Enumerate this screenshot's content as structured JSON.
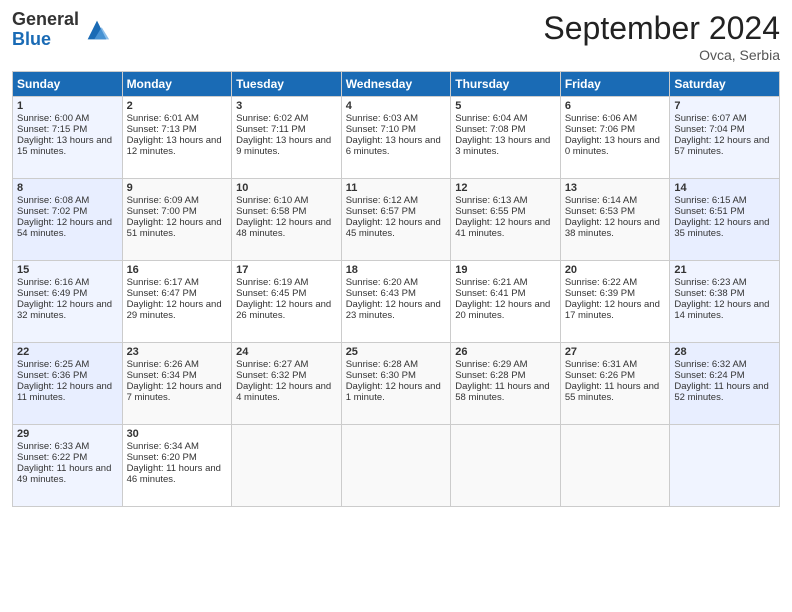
{
  "logo": {
    "general": "General",
    "blue": "Blue"
  },
  "title": "September 2024",
  "location": "Ovca, Serbia",
  "days_of_week": [
    "Sunday",
    "Monday",
    "Tuesday",
    "Wednesday",
    "Thursday",
    "Friday",
    "Saturday"
  ],
  "weeks": [
    [
      {
        "day": "1",
        "sunrise": "Sunrise: 6:00 AM",
        "sunset": "Sunset: 7:15 PM",
        "daylight": "Daylight: 13 hours and 15 minutes."
      },
      {
        "day": "2",
        "sunrise": "Sunrise: 6:01 AM",
        "sunset": "Sunset: 7:13 PM",
        "daylight": "Daylight: 13 hours and 12 minutes."
      },
      {
        "day": "3",
        "sunrise": "Sunrise: 6:02 AM",
        "sunset": "Sunset: 7:11 PM",
        "daylight": "Daylight: 13 hours and 9 minutes."
      },
      {
        "day": "4",
        "sunrise": "Sunrise: 6:03 AM",
        "sunset": "Sunset: 7:10 PM",
        "daylight": "Daylight: 13 hours and 6 minutes."
      },
      {
        "day": "5",
        "sunrise": "Sunrise: 6:04 AM",
        "sunset": "Sunset: 7:08 PM",
        "daylight": "Daylight: 13 hours and 3 minutes."
      },
      {
        "day": "6",
        "sunrise": "Sunrise: 6:06 AM",
        "sunset": "Sunset: 7:06 PM",
        "daylight": "Daylight: 13 hours and 0 minutes."
      },
      {
        "day": "7",
        "sunrise": "Sunrise: 6:07 AM",
        "sunset": "Sunset: 7:04 PM",
        "daylight": "Daylight: 12 hours and 57 minutes."
      }
    ],
    [
      {
        "day": "8",
        "sunrise": "Sunrise: 6:08 AM",
        "sunset": "Sunset: 7:02 PM",
        "daylight": "Daylight: 12 hours and 54 minutes."
      },
      {
        "day": "9",
        "sunrise": "Sunrise: 6:09 AM",
        "sunset": "Sunset: 7:00 PM",
        "daylight": "Daylight: 12 hours and 51 minutes."
      },
      {
        "day": "10",
        "sunrise": "Sunrise: 6:10 AM",
        "sunset": "Sunset: 6:58 PM",
        "daylight": "Daylight: 12 hours and 48 minutes."
      },
      {
        "day": "11",
        "sunrise": "Sunrise: 6:12 AM",
        "sunset": "Sunset: 6:57 PM",
        "daylight": "Daylight: 12 hours and 45 minutes."
      },
      {
        "day": "12",
        "sunrise": "Sunrise: 6:13 AM",
        "sunset": "Sunset: 6:55 PM",
        "daylight": "Daylight: 12 hours and 41 minutes."
      },
      {
        "day": "13",
        "sunrise": "Sunrise: 6:14 AM",
        "sunset": "Sunset: 6:53 PM",
        "daylight": "Daylight: 12 hours and 38 minutes."
      },
      {
        "day": "14",
        "sunrise": "Sunrise: 6:15 AM",
        "sunset": "Sunset: 6:51 PM",
        "daylight": "Daylight: 12 hours and 35 minutes."
      }
    ],
    [
      {
        "day": "15",
        "sunrise": "Sunrise: 6:16 AM",
        "sunset": "Sunset: 6:49 PM",
        "daylight": "Daylight: 12 hours and 32 minutes."
      },
      {
        "day": "16",
        "sunrise": "Sunrise: 6:17 AM",
        "sunset": "Sunset: 6:47 PM",
        "daylight": "Daylight: 12 hours and 29 minutes."
      },
      {
        "day": "17",
        "sunrise": "Sunrise: 6:19 AM",
        "sunset": "Sunset: 6:45 PM",
        "daylight": "Daylight: 12 hours and 26 minutes."
      },
      {
        "day": "18",
        "sunrise": "Sunrise: 6:20 AM",
        "sunset": "Sunset: 6:43 PM",
        "daylight": "Daylight: 12 hours and 23 minutes."
      },
      {
        "day": "19",
        "sunrise": "Sunrise: 6:21 AM",
        "sunset": "Sunset: 6:41 PM",
        "daylight": "Daylight: 12 hours and 20 minutes."
      },
      {
        "day": "20",
        "sunrise": "Sunrise: 6:22 AM",
        "sunset": "Sunset: 6:39 PM",
        "daylight": "Daylight: 12 hours and 17 minutes."
      },
      {
        "day": "21",
        "sunrise": "Sunrise: 6:23 AM",
        "sunset": "Sunset: 6:38 PM",
        "daylight": "Daylight: 12 hours and 14 minutes."
      }
    ],
    [
      {
        "day": "22",
        "sunrise": "Sunrise: 6:25 AM",
        "sunset": "Sunset: 6:36 PM",
        "daylight": "Daylight: 12 hours and 11 minutes."
      },
      {
        "day": "23",
        "sunrise": "Sunrise: 6:26 AM",
        "sunset": "Sunset: 6:34 PM",
        "daylight": "Daylight: 12 hours and 7 minutes."
      },
      {
        "day": "24",
        "sunrise": "Sunrise: 6:27 AM",
        "sunset": "Sunset: 6:32 PM",
        "daylight": "Daylight: 12 hours and 4 minutes."
      },
      {
        "day": "25",
        "sunrise": "Sunrise: 6:28 AM",
        "sunset": "Sunset: 6:30 PM",
        "daylight": "Daylight: 12 hours and 1 minute."
      },
      {
        "day": "26",
        "sunrise": "Sunrise: 6:29 AM",
        "sunset": "Sunset: 6:28 PM",
        "daylight": "Daylight: 11 hours and 58 minutes."
      },
      {
        "day": "27",
        "sunrise": "Sunrise: 6:31 AM",
        "sunset": "Sunset: 6:26 PM",
        "daylight": "Daylight: 11 hours and 55 minutes."
      },
      {
        "day": "28",
        "sunrise": "Sunrise: 6:32 AM",
        "sunset": "Sunset: 6:24 PM",
        "daylight": "Daylight: 11 hours and 52 minutes."
      }
    ],
    [
      {
        "day": "29",
        "sunrise": "Sunrise: 6:33 AM",
        "sunset": "Sunset: 6:22 PM",
        "daylight": "Daylight: 11 hours and 49 minutes."
      },
      {
        "day": "30",
        "sunrise": "Sunrise: 6:34 AM",
        "sunset": "Sunset: 6:20 PM",
        "daylight": "Daylight: 11 hours and 46 minutes."
      },
      {
        "day": "",
        "sunrise": "",
        "sunset": "",
        "daylight": ""
      },
      {
        "day": "",
        "sunrise": "",
        "sunset": "",
        "daylight": ""
      },
      {
        "day": "",
        "sunrise": "",
        "sunset": "",
        "daylight": ""
      },
      {
        "day": "",
        "sunrise": "",
        "sunset": "",
        "daylight": ""
      },
      {
        "day": "",
        "sunrise": "",
        "sunset": "",
        "daylight": ""
      }
    ]
  ]
}
